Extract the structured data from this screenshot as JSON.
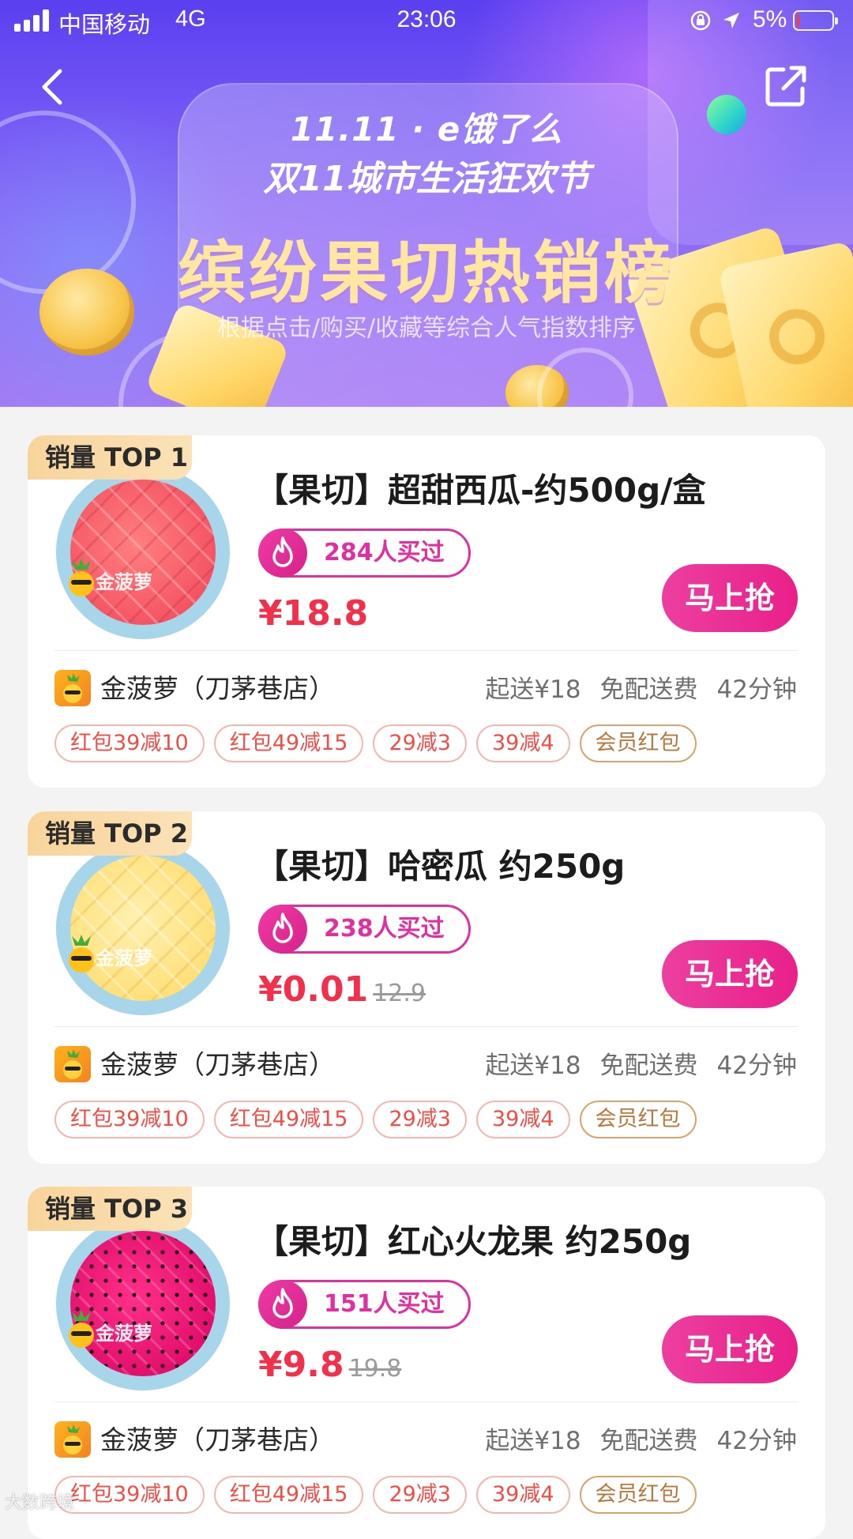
{
  "status_bar": {
    "carrier": "中国移动",
    "network": "4G",
    "time": "23:06",
    "battery_percent": "5%"
  },
  "banner": {
    "logo_text": "11.11 · e饿了么",
    "subtitle": "双11城市生活狂欢节",
    "title": "缤纷果切热销榜",
    "description": "根据点击/购买/收藏等综合人气指数排序"
  },
  "nav": {
    "back_icon": "chevron-left-icon",
    "share_icon": "share-icon"
  },
  "colors": {
    "accent_pink": "#e9208a",
    "price_red": "#f2304b",
    "banner_purple": "#7a5cf5",
    "badge_gold": "#f8d49a"
  },
  "watermark": "大数跨境",
  "products": [
    {
      "rank": "销量 TOP 1",
      "title": "【果切】超甜西瓜-约500g/盒",
      "sold": "284人买过",
      "price": "¥18.8",
      "original_price": "",
      "buy_label": "马上抢",
      "plate_logo": "金菠萝",
      "shop_name": "金菠萝（刀茅巷店）",
      "min_order": "起送¥18",
      "delivery_fee": "免配送费",
      "delivery_time": "42分钟",
      "tags": [
        "红包39减10",
        "红包49减15",
        "29减3",
        "39减4"
      ],
      "member_tag": "会员红包"
    },
    {
      "rank": "销量 TOP 2",
      "title": "【果切】哈密瓜 约250g",
      "sold": "238人买过",
      "price": "¥0.01",
      "original_price": "12.9",
      "buy_label": "马上抢",
      "plate_logo": "金菠萝",
      "shop_name": "金菠萝（刀茅巷店）",
      "min_order": "起送¥18",
      "delivery_fee": "免配送费",
      "delivery_time": "42分钟",
      "tags": [
        "红包39减10",
        "红包49减15",
        "29减3",
        "39减4"
      ],
      "member_tag": "会员红包"
    },
    {
      "rank": "销量 TOP 3",
      "title": "【果切】红心火龙果 约250g",
      "sold": "151人买过",
      "price": "¥9.8",
      "original_price": "19.8",
      "buy_label": "马上抢",
      "plate_logo": "金菠萝",
      "shop_name": "金菠萝（刀茅巷店）",
      "min_order": "起送¥18",
      "delivery_fee": "免配送费",
      "delivery_time": "42分钟",
      "tags": [
        "红包39减10",
        "红包49减15",
        "29减3",
        "39减4"
      ],
      "member_tag": "会员红包"
    }
  ]
}
